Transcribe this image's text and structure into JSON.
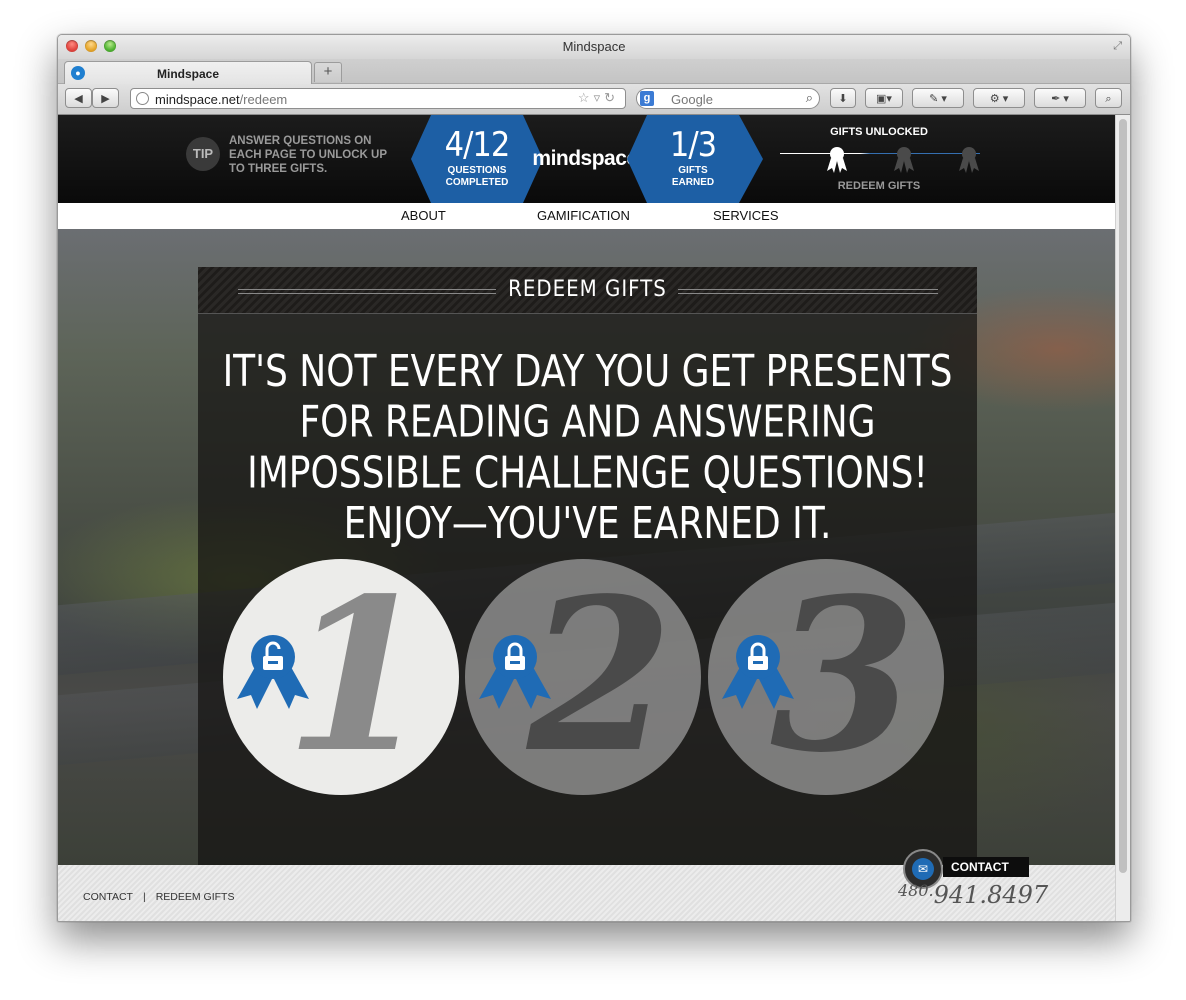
{
  "window": {
    "title": "Mindspace"
  },
  "tab": {
    "label": "Mindspace",
    "new_tab": "+"
  },
  "toolbar": {
    "back": "◀",
    "forward": "▶",
    "url_host": "mindspace.net",
    "url_path": "/redeem",
    "search_engine": "g",
    "search_placeholder": "Google",
    "download": "⬇",
    "gear": "⚙"
  },
  "header": {
    "tip_badge": "TIP",
    "tip_text": "ANSWER QUESTIONS ON EACH PAGE TO UNLOCK UP TO THREE GIFTS.",
    "questions_value": "4/12",
    "questions_label1": "QUESTIONS",
    "questions_label2": "COMPLETED",
    "brand": "mindspace",
    "gifts_value": "1/3",
    "gifts_label1": "GIFTS",
    "gifts_label2": "EARNED",
    "gifts_unlocked_title": "GIFTS UNLOCKED",
    "redeem_link": "REDEEM GIFTS"
  },
  "nav": {
    "items": [
      "ABOUT",
      "GAMIFICATION",
      "SERVICES"
    ]
  },
  "panel": {
    "title": "REDEEM GIFTS",
    "headline": "IT'S NOT EVERY DAY YOU GET PRESENTS FOR READING AND ANSWERING IMPOSSIBLE CHALLENGE QUESTIONS! ENJOY—YOU'VE EARNED IT.",
    "gifts": [
      {
        "number": "1",
        "state": "unlocked"
      },
      {
        "number": "2",
        "state": "locked"
      },
      {
        "number": "3",
        "state": "locked"
      }
    ]
  },
  "footer": {
    "links": [
      "CONTACT",
      "REDEEM GIFTS"
    ],
    "separator": "|",
    "contact_label": "CONTACT",
    "phone_area": "480.",
    "phone_number": "941.8497"
  },
  "colors": {
    "brand_blue": "#1d5fa5",
    "dark": "#111111"
  }
}
